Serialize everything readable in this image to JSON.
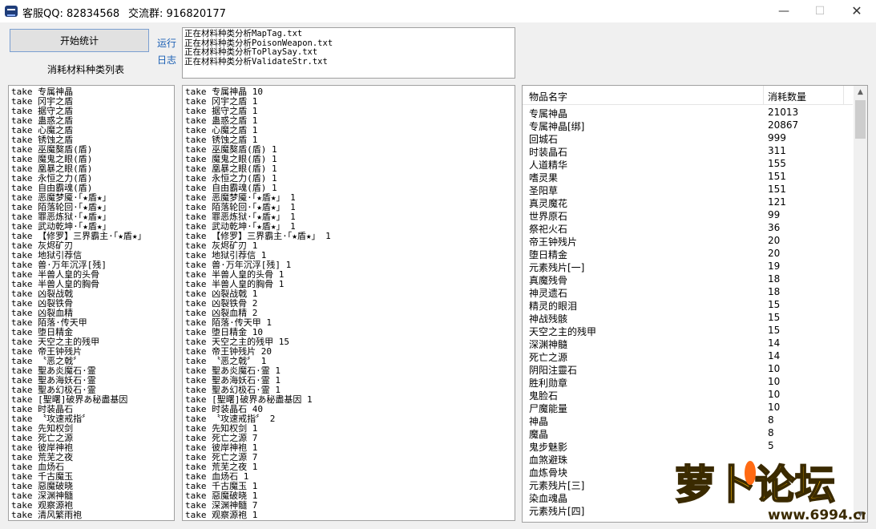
{
  "titlebar": {
    "qq_text": "客服QQ:  82834568",
    "group_text": "交流群:  916820177"
  },
  "controls": {
    "start_label": "开始统计",
    "run_label": "运行",
    "log_label": "日志",
    "caption": "消耗材料种类列表"
  },
  "log_lines": [
    "正在材料种类分析MapTag.txt",
    "正在材料种类分析PoisonWeapon.txt",
    "正在材料种类分析ToPlaySay.txt",
    "正在材料种类分析ValidateStr.txt"
  ],
  "left_list": [
    "take 专属神晶",
    "take 冈宇之盾",
    "take 据守之盾",
    "take 蛊惑之盾",
    "take 心魔之盾",
    "take 锈蚀之盾",
    "take 巫魔獒盾(盾)",
    "take 魔鬼之眼(盾)",
    "take 凰暴之眼(盾)",
    "take 永恒之力(盾)",
    "take 自由霸魂(盾)",
    "take 恶魔梦魇·「★盾★」",
    "take 陌落轮回·「★盾★」",
    "take 罪恶炼狱·「★盾★」",
    "take 武动乾坤·「★盾★」",
    "take 【修罗】三界霸主·「★盾★」",
    "take 灰烬矿刃",
    "take 地狱引荐信",
    "take 兽·万年沉浮[残]",
    "take 半兽人皇的头骨",
    "take 半兽人皇的胸骨",
    "take 凶裂战戟",
    "take 凶裂铁骨",
    "take 凶裂血精",
    "take 陌落·传天甲",
    "take 堕日精金",
    "take 天空之主的残甲",
    "take 帝王钟残片",
    "take 〝恶之戟〞",
    "take 聖あ炎魔石·霊",
    "take 聖あ海妖石·霊",
    "take 聖あ幻极石·霊",
    "take [聖曙]破界あ秘盡基因",
    "take 时装晶石",
    "take 〝攻速戒指〞",
    "take 先知权剑",
    "take 死亡之源",
    "take 彼岸神袍",
    "take 荒芜之夜",
    "take 血炀石",
    "take 千古魔玉",
    "take 惡魔破晓",
    "take 深渊神髓",
    "take 观察源袍",
    "take 清风繁雨袍"
  ],
  "mid_list": [
    "take 专属神晶 10",
    "take 冈宇之盾 1",
    "take 据守之盾 1",
    "take 蛊惑之盾 1",
    "take 心魔之盾 1",
    "take 锈蚀之盾 1",
    "take 巫魔獒盾(盾) 1",
    "take 魔鬼之眼(盾) 1",
    "take 凰暴之眼(盾) 1",
    "take 永恒之力(盾) 1",
    "take 自由霸魂(盾) 1",
    "take 恶魔梦魇·「★盾★」 1",
    "take 陌落轮回·「★盾★」 1",
    "take 罪恶炼狱·「★盾★」 1",
    "take 武动乾坤·「★盾★」 1",
    "take 【修罗】三界霸主·「★盾★」 1",
    "take 灰烬矿刃 1",
    "take 地狱引荐信 1",
    "take 兽·万年沉浮[残] 1",
    "take 半兽人皇的头骨 1",
    "take 半兽人皇的胸骨 1",
    "take 凶裂战戟 1",
    "take 凶裂铁骨 2",
    "take 凶裂血精 2",
    "take 陌落·传天甲 1",
    "take 堕日精金 10",
    "take 天空之主的残甲 15",
    "take 帝王钟残片 20",
    "take 〝恶之戟〞 1",
    "take 聖あ炎魔石·霊 1",
    "take 聖あ海妖石·霊 1",
    "take 聖あ幻极石·霊 1",
    "take [聖曙]破界あ秘盡基因 1",
    "take 时装晶石 40",
    "take 〝攻速戒指〞 2",
    "take 先知权剑 1",
    "take 死亡之源 7",
    "take 彼岸神袍 1",
    "take 死亡之源 7",
    "take 荒芜之夜 1",
    "take 血炀石 1",
    "take 千古魔玉 1",
    "take 惡魔破晓 1",
    "take 深渊神髓 7",
    "take 观察源袍 1"
  ],
  "table": {
    "col_name": "物品名字",
    "col_count": "消耗数量",
    "rows": [
      [
        "专属神晶",
        "21013"
      ],
      [
        "专属神晶[绑]",
        "20867"
      ],
      [
        "回城石",
        "999"
      ],
      [
        "时装晶石",
        "311"
      ],
      [
        "人道精华",
        "155"
      ],
      [
        "嗜灵果",
        "151"
      ],
      [
        "圣阳草",
        "151"
      ],
      [
        "真灵魔花",
        "121"
      ],
      [
        "世界原石",
        "99"
      ],
      [
        "祭祀火石",
        "36"
      ],
      [
        "帝王钟残片",
        "20"
      ],
      [
        "堕日精金",
        "20"
      ],
      [
        "元素残片[一]",
        "19"
      ],
      [
        "真魔残骨",
        "18"
      ],
      [
        "神灵遗石",
        "18"
      ],
      [
        "精灵的眼泪",
        "15"
      ],
      [
        "神战残骸",
        "15"
      ],
      [
        "天空之主的残甲",
        "15"
      ],
      [
        "深渊神髓",
        "14"
      ],
      [
        "死亡之源",
        "14"
      ],
      [
        "阴阳注靈石",
        "10"
      ],
      [
        "胜利勋章",
        "10"
      ],
      [
        "鬼脸石",
        "10"
      ],
      [
        "尸魔能量",
        "10"
      ],
      [
        "神晶",
        "8"
      ],
      [
        "魔晶",
        "8"
      ],
      [
        "鬼步魅影",
        "5"
      ],
      [
        "血煞避珠",
        ""
      ],
      [
        "血炼骨块",
        ""
      ],
      [
        "元素残片[三]",
        ""
      ],
      [
        "染血魂晶",
        ""
      ],
      [
        "元素残片[四]",
        ""
      ]
    ]
  },
  "watermark": {
    "brand": "萝卜论坛",
    "site": "www.6994.cn"
  },
  "colors": {
    "accent_link": "#1a5fb4",
    "button_border": "#7a9fd1",
    "watermark_fill": "#f5b400",
    "watermark_carrot": "#ff6a13"
  }
}
